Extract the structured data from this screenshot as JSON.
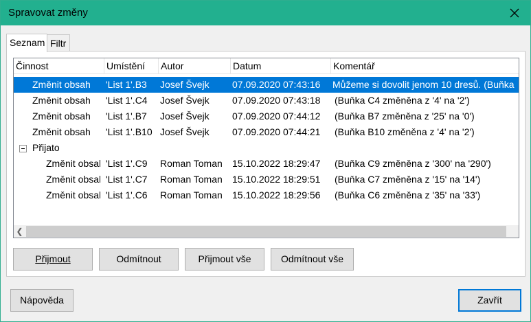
{
  "dialog": {
    "title": "Spravovat změny",
    "close_icon": "close-icon"
  },
  "tabs": [
    {
      "label": "Seznam",
      "active": true
    },
    {
      "label": "Filtr",
      "active": false
    }
  ],
  "columns": [
    "Činnost",
    "Umístění",
    "Autor",
    "Datum",
    "Komentář"
  ],
  "rows": [
    {
      "action": "Změnit obsah",
      "location": "'List 1'.B3",
      "author": "Josef Švejk",
      "date": "07.09.2020 07:43:16",
      "comment": "Můžeme si dovolit jenom 10 dresů. (Buňka"
    },
    {
      "action": "Změnit obsah",
      "location": "'List 1'.C4",
      "author": "Josef Švejk",
      "date": "07.09.2020 07:43:18",
      "comment": "(Buňka C4 změněna z '4' na '2')"
    },
    {
      "action": "Změnit obsah",
      "location": "'List 1'.B7",
      "author": "Josef Švejk",
      "date": "07.09.2020 07:44:12",
      "comment": "(Buňka B7 změněna z '25' na '0')"
    },
    {
      "action": "Změnit obsah",
      "location": "'List 1'.B10",
      "author": "Josef Švejk",
      "date": "07.09.2020 07:44:21",
      "comment": "(Buňka B10 změněna z '4' na '2')"
    }
  ],
  "accepted_group": {
    "label": "Přijato",
    "rows": [
      {
        "action": "Změnit obsah",
        "location": "'List 1'.C9",
        "author": "Roman Toman",
        "date": "15.10.2022 18:29:47",
        "comment": "(Buňka C9 změněna z '300' na '290')"
      },
      {
        "action": "Změnit obsah",
        "location": "'List 1'.C7",
        "author": "Roman Toman",
        "date": "15.10.2022 18:29:51",
        "comment": "(Buňka C7 změněna z '15' na '14')"
      },
      {
        "action": "Změnit obsah",
        "location": "'List 1'.C6",
        "author": "Roman Toman",
        "date": "15.10.2022 18:29:56",
        "comment": "(Buňka C6 změněna z '35' na '33')"
      }
    ]
  },
  "buttons": {
    "accept": "Přijmout",
    "reject": "Odmítnout",
    "accept_all": "Přijmout vše",
    "reject_all": "Odmítnout vše",
    "help": "Nápověda",
    "close": "Zavřít"
  },
  "colors": {
    "titlebar": "#22b08f",
    "selection": "#0078d7"
  }
}
